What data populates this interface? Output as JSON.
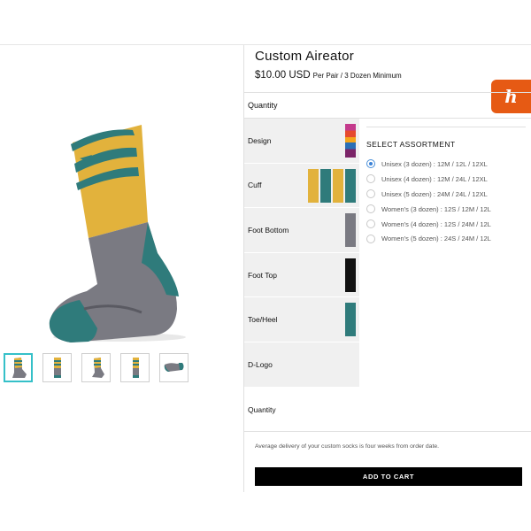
{
  "product": {
    "title": "Custom Aireator",
    "price": "$10.00 USD",
    "price_note": "Per Pair / 3 Dozen Minimum"
  },
  "quantity_label": "Quantity",
  "parts": [
    {
      "label": "Design"
    },
    {
      "label": "Cuff"
    },
    {
      "label": "Foot Bottom"
    },
    {
      "label": "Foot Top"
    },
    {
      "label": "Toe/Heel"
    },
    {
      "label": "D-Logo"
    }
  ],
  "colors": {
    "mustard": "#e2b23c",
    "teal": "#2f7b7b",
    "gray": "#7a7a82",
    "black": "#111111",
    "panel_bg": "#f0f0f0",
    "cart_button": "#000000",
    "honey_orange": "#e65a14"
  },
  "assortment": {
    "title": "SELECT ASSORTMENT",
    "options": [
      {
        "label": "Unisex (3 dozen) : 12M / 12L / 12XL",
        "checked": true
      },
      {
        "label": "Unisex (4 dozen) : 12M / 24L / 12XL",
        "checked": false
      },
      {
        "label": "Unisex (5 dozen) : 24M / 24L / 12XL",
        "checked": false
      },
      {
        "label": "Women's (3 dozen) : 12S / 12M / 12L",
        "checked": false
      },
      {
        "label": "Women's (4 dozen) : 12S / 24M / 12L",
        "checked": false
      },
      {
        "label": "Women's (5 dozen) : 24S / 24M / 12L",
        "checked": false
      }
    ]
  },
  "quantity2_label": "Quantity",
  "delivery_note": "Average delivery of your custom socks is four weeks from order date.",
  "add_to_cart_label": "ADD TO CART",
  "honey_icon_glyph": "h"
}
